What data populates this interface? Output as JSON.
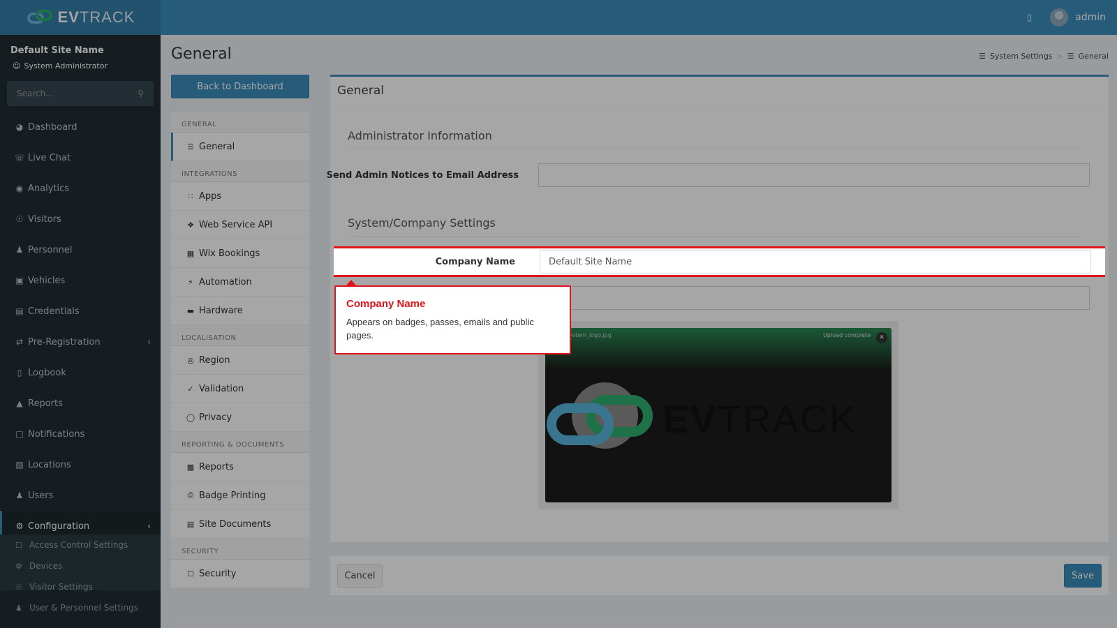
{
  "app": {
    "logo_bold": "EV",
    "logo_rest": "TRACK"
  },
  "topbar": {
    "user": "admin",
    "book_icon": "book-icon"
  },
  "sidebar": {
    "site_name": "Default Site Name",
    "role": "System Administrator",
    "search_placeholder": "Search...",
    "items": [
      {
        "label": "Dashboard"
      },
      {
        "label": "Live Chat"
      },
      {
        "label": "Analytics"
      },
      {
        "label": "Visitors"
      },
      {
        "label": "Personnel"
      },
      {
        "label": "Vehicles"
      },
      {
        "label": "Credentials"
      },
      {
        "label": "Pre-Registration"
      },
      {
        "label": "Logbook"
      },
      {
        "label": "Reports"
      },
      {
        "label": "Notifications"
      },
      {
        "label": "Locations"
      },
      {
        "label": "Users"
      },
      {
        "label": "Configuration"
      }
    ],
    "submenu": [
      {
        "label": "Access Control Settings"
      },
      {
        "label": "Devices"
      },
      {
        "label": "Visitor Settings"
      },
      {
        "label": "User & Personnel Settings"
      }
    ]
  },
  "page": {
    "title": "General",
    "back_label": "Back to Dashboard"
  },
  "breadcrumb": {
    "parent": "System Settings",
    "sep": ">",
    "current": "General"
  },
  "settings_nav": {
    "general": "GENERAL",
    "general_item": "General",
    "integrations": "INTEGRATIONS",
    "apps": "Apps",
    "api": "Web Service API",
    "wix": "Wix Bookings",
    "automation": "Automation",
    "hardware": "Hardware",
    "localisation": "LOCALISATION",
    "region": "Region",
    "validation": "Validation",
    "privacy": "Privacy",
    "reporting": "REPORTING & DOCUMENTS",
    "reports": "Reports",
    "badge": "Badge Printing",
    "docs": "Site Documents",
    "security_h": "SECURITY",
    "security": "Security"
  },
  "main": {
    "box_title": "General",
    "admin_section": "Administrator Information",
    "email_label": "Send Admin Notices to Email Address",
    "email_value": "",
    "company_section": "System/Company Settings",
    "company_label": "Company Name",
    "company_value": "Default Site Name",
    "preview_file": "system_logo.jpg",
    "preview_status": "Upload complete",
    "preview_logo_bold": "EV",
    "preview_logo_rest": "TRACK"
  },
  "footer": {
    "cancel": "Cancel",
    "save": "Save"
  },
  "tooltip": {
    "title": "Company Name",
    "body": "Appears on badges, passes, emails and public pages."
  },
  "colors": {
    "primary": "#3c8dbc",
    "sidebar": "#222d32",
    "highlight": "#e0131a"
  }
}
